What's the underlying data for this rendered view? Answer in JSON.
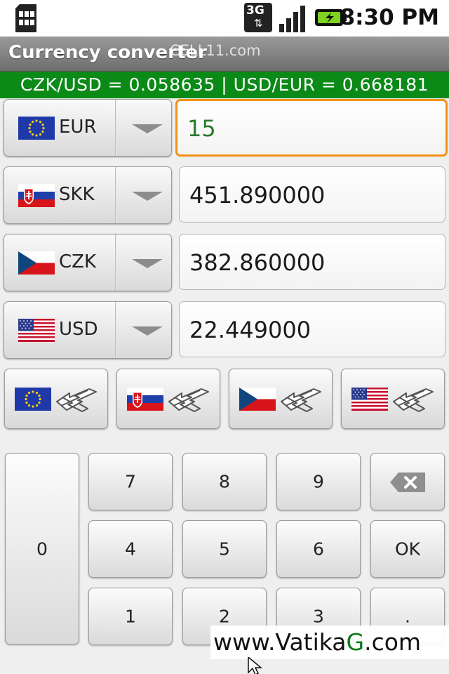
{
  "status": {
    "time": "8:30 PM",
    "network_label": "3G",
    "icons": [
      "sim-icon",
      "network-3g-icon",
      "signal-bars-icon",
      "battery-charging-icon"
    ]
  },
  "titlebar": {
    "title": "Currency converter",
    "watermark": "CELL11.com"
  },
  "ratebar": {
    "text": "CZK/USD = 0.058635 | USD/EUR = 0.668181",
    "color": "#0b8a17"
  },
  "rows": [
    {
      "code": "EUR",
      "value": "15",
      "flag": "eu-flag-icon"
    },
    {
      "code": "SKK",
      "value": "451.890000",
      "flag": "slovakia-flag-icon"
    },
    {
      "code": "CZK",
      "value": "382.860000",
      "flag": "czech-flag-icon"
    },
    {
      "code": "USD",
      "value": "22.449000",
      "flag": "usa-flag-icon"
    }
  ],
  "swap_buttons": [
    "eu-flag-icon",
    "slovakia-flag-icon",
    "czech-flag-icon",
    "usa-flag-icon"
  ],
  "keypad": {
    "zero": "0",
    "k7": "7",
    "k8": "8",
    "k9": "9",
    "k4": "4",
    "k5": "5",
    "k6": "6",
    "k1": "1",
    "k2": "2",
    "k3": "3",
    "ok": "OK",
    "dot": "."
  },
  "watermark_bottom": {
    "prefix": "www.Vatika",
    "g": "G",
    "suffix": ".com"
  },
  "colors": {
    "focus_border": "#f29216",
    "rate_bar": "#0b8a17"
  }
}
